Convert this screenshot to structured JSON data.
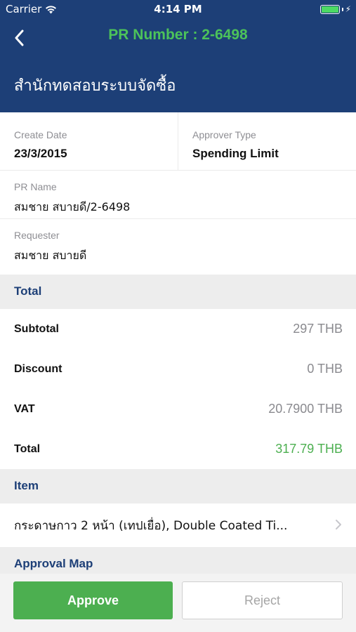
{
  "status_bar": {
    "carrier": "Carrier",
    "time": "4:14 PM"
  },
  "nav": {
    "title": "PR Number : 2-6498",
    "org": "สำนักทดสอบระบบจัดซื้อ"
  },
  "details": {
    "create_date_label": "Create Date",
    "create_date_value": "23/3/2015",
    "approver_type_label": "Approver Type",
    "approver_type_value": "Spending Limit",
    "pr_name_label": "PR Name",
    "pr_name_value": "สมชาย สบายดี/2-6498",
    "requester_label": "Requester",
    "requester_value": "สมชาย สบายดี"
  },
  "total_section": {
    "header": "Total",
    "rows": [
      {
        "label": "Subtotal",
        "value": "297 THB"
      },
      {
        "label": "Discount",
        "value": "0 THB"
      },
      {
        "label": "VAT",
        "value": "20.7900 THB"
      },
      {
        "label": "Total",
        "value": "317.79 THB"
      }
    ]
  },
  "item_section": {
    "header": "Item",
    "items": [
      {
        "name": "กระดาษกาว 2 หน้า (เทปเยื่อ), Double Coated Ti..."
      }
    ]
  },
  "approval_map": {
    "header": "Approval Map"
  },
  "actions": {
    "approve": "Approve",
    "reject": "Reject"
  },
  "colors": {
    "nav_bg": "#1d3f77",
    "accent_green": "#4caf50",
    "section_bg": "#ededed"
  }
}
